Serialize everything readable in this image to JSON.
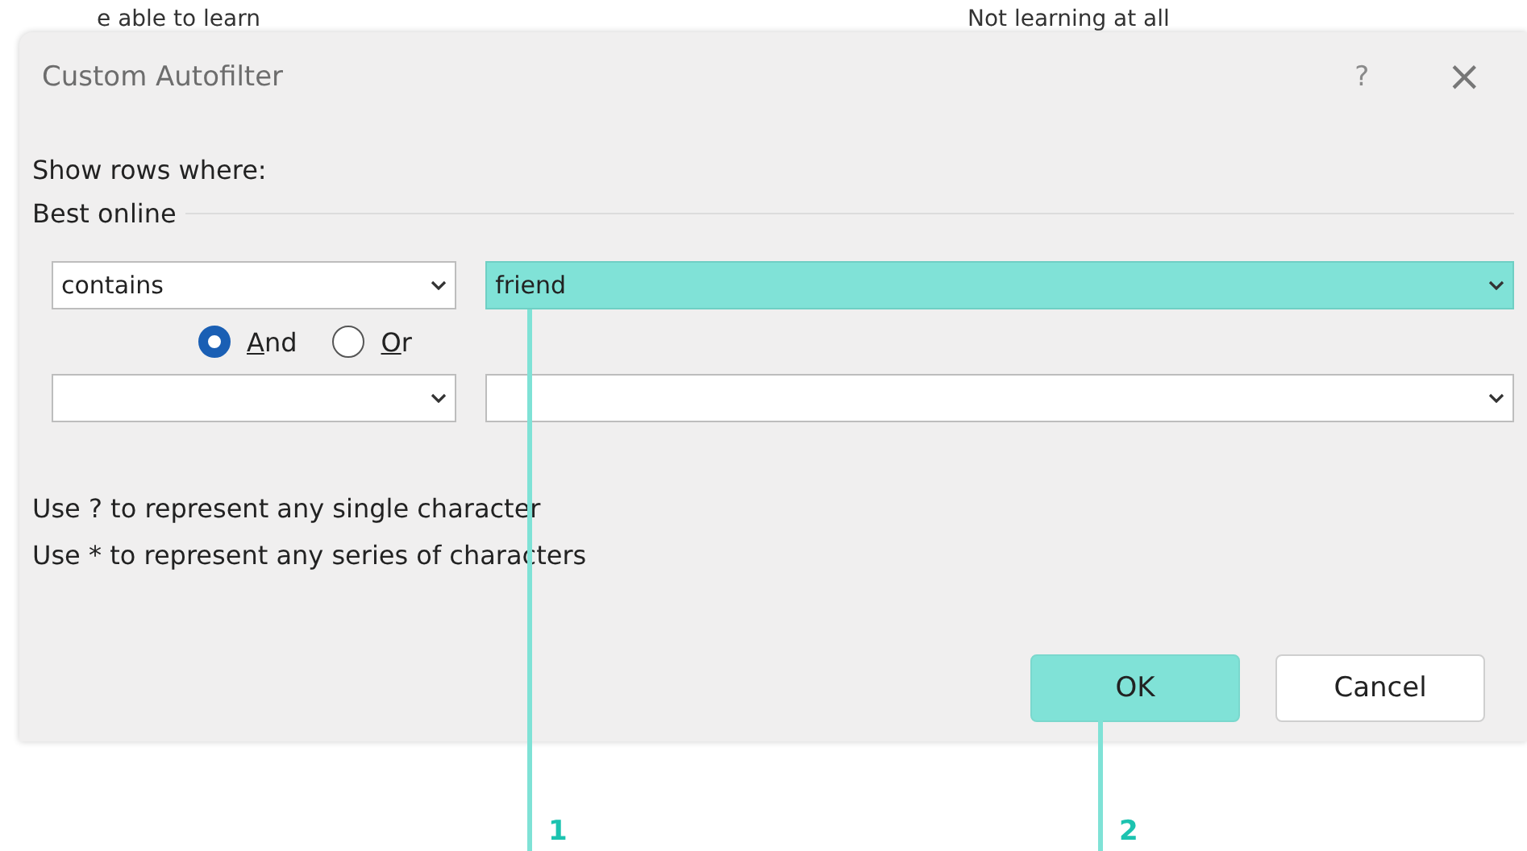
{
  "background_texts": [
    "e able to learn",
    "Not learning at all"
  ],
  "dialog": {
    "title": "Custom Autofilter",
    "help": "?",
    "close": "×",
    "prompt": "Show rows where:",
    "group_label": "Best online",
    "conditions": [
      {
        "operator": "contains",
        "value": "friend",
        "highlighted": true
      },
      {
        "highlighted": false
      }
    ],
    "joins": [
      {
        "label": "And",
        "selected": true
      },
      {
        "label": "Or",
        "selected": false
      }
    ],
    "hints": [
      "Use ? to represent any single character",
      "Use * to represent any series of characters"
    ],
    "buttons": [
      {
        "label": "OK",
        "highlighted": true
      },
      {
        "label": "Cancel",
        "highlighted": false
      }
    ]
  },
  "callouts": [
    {
      "label": "1"
    },
    {
      "label": "2"
    }
  ]
}
